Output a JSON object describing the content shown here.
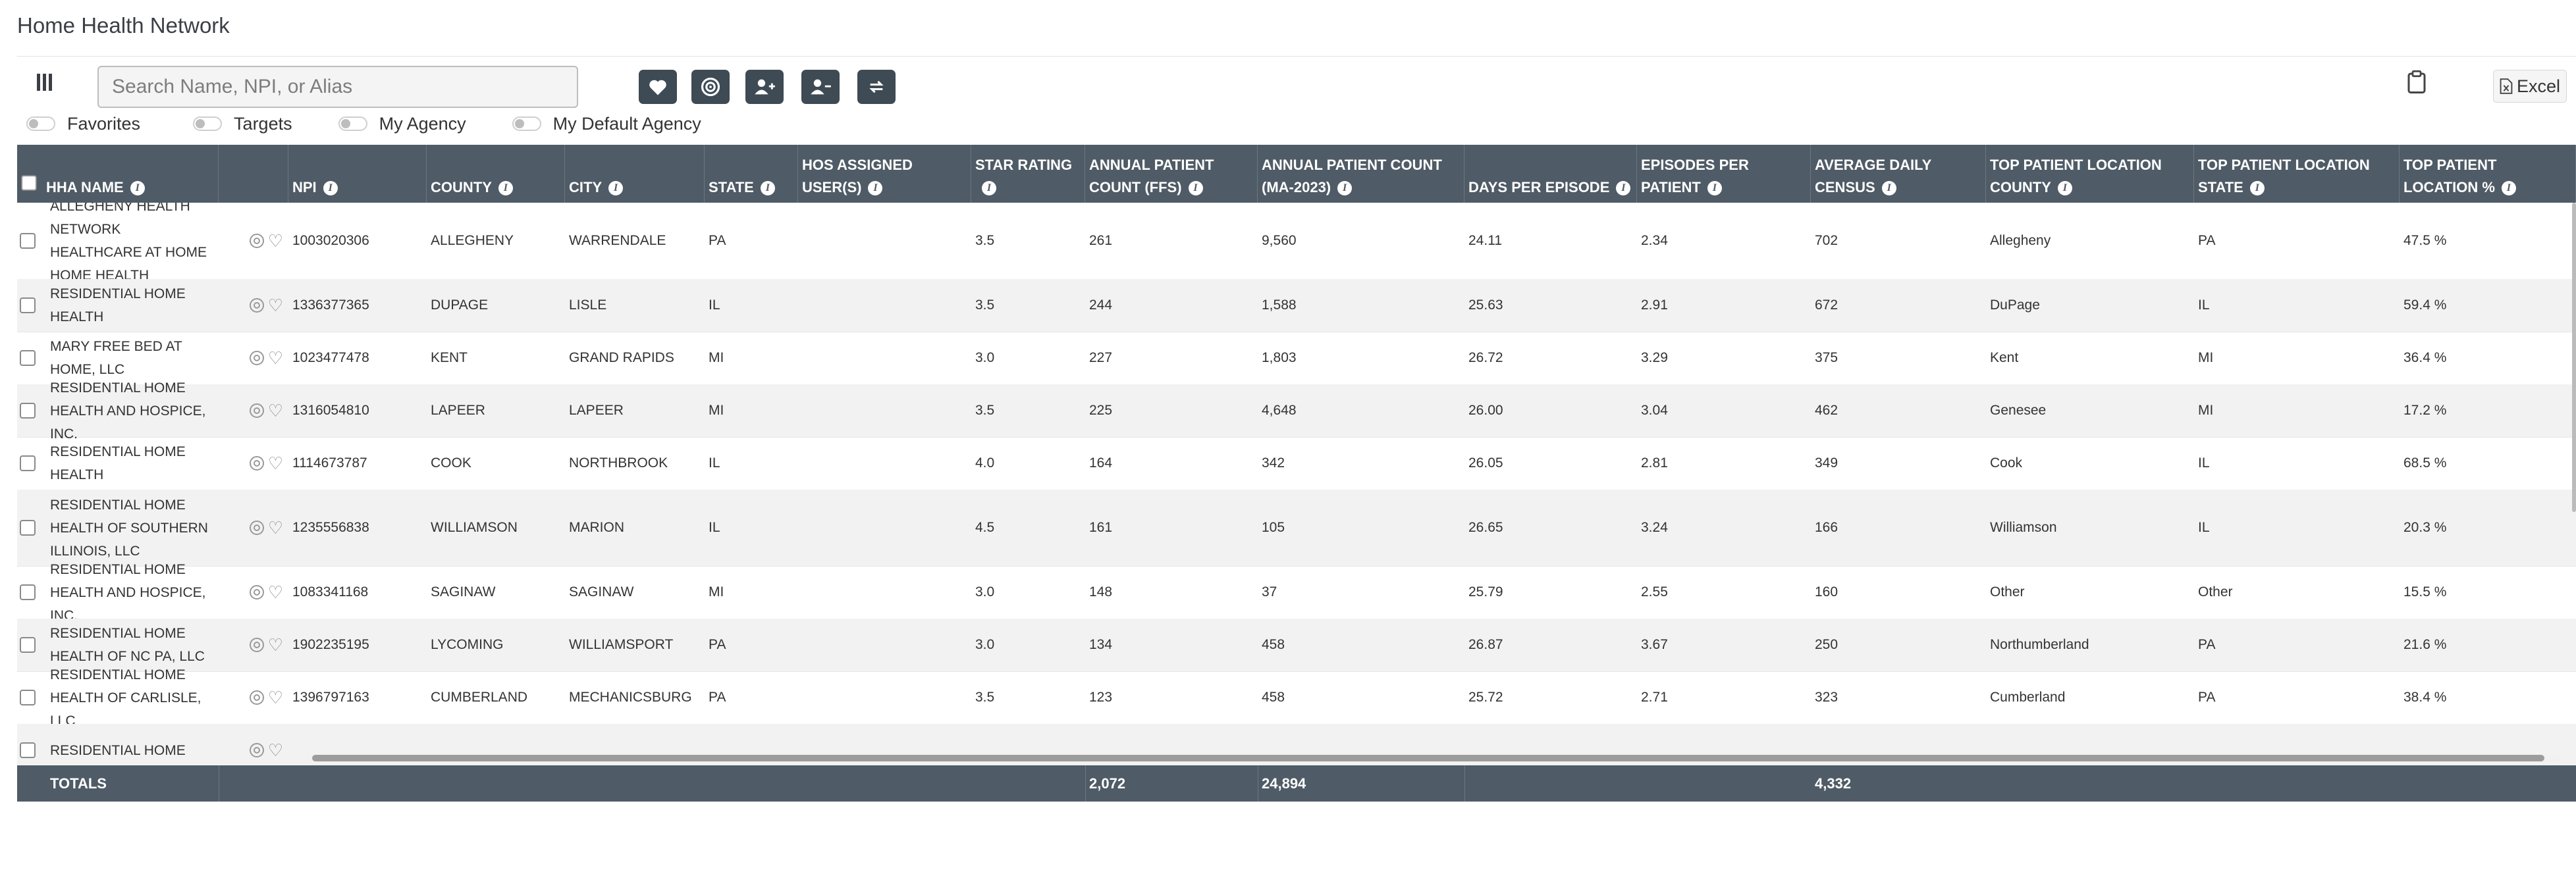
{
  "page": {
    "title": "Home Health Network"
  },
  "toolbar": {
    "search_placeholder": "Search Name, NPI, or Alias",
    "excel_label": "Excel"
  },
  "toggles": [
    "Favorites",
    "Targets",
    "My Agency",
    "My Default Agency"
  ],
  "table": {
    "columns": [
      "HHA NAME",
      "",
      "NPI",
      "COUNTY",
      "CITY",
      "STATE",
      "HOS ASSIGNED USER(S)",
      "STAR RATING",
      "ANNUAL PATIENT COUNT (FFS)",
      "ANNUAL PATIENT COUNT (MA-2023)",
      "DAYS PER EPISODE",
      "EPISODES PER PATIENT",
      "AVERAGE DAILY CENSUS",
      "TOP PATIENT LOCATION COUNTY",
      "TOP PATIENT LOCATION STATE",
      "TOP PATIENT LOCATION %"
    ],
    "rows": [
      {
        "name": "ALLEGHENY HEALTH NETWORK HEALTHCARE AT HOME HOME HEALTH",
        "npi": "1003020306",
        "county": "ALLEGHENY",
        "city": "WARRENDALE",
        "state": "PA",
        "hos": "",
        "star": "3.5",
        "ffs": "261",
        "ma": "9,560",
        "dpe": "24.11",
        "epp": "2.34",
        "adc": "702",
        "tpl_county": "Allegheny",
        "tpl_state": "PA",
        "tpl_pct": "47.5 %"
      },
      {
        "name": "RESIDENTIAL HOME HEALTH",
        "npi": "1336377365",
        "county": "DUPAGE",
        "city": "LISLE",
        "state": "IL",
        "hos": "",
        "star": "3.5",
        "ffs": "244",
        "ma": "1,588",
        "dpe": "25.63",
        "epp": "2.91",
        "adc": "672",
        "tpl_county": "DuPage",
        "tpl_state": "IL",
        "tpl_pct": "59.4 %"
      },
      {
        "name": "MARY FREE BED AT HOME, LLC",
        "npi": "1023477478",
        "county": "KENT",
        "city": "GRAND RAPIDS",
        "state": "MI",
        "hos": "",
        "star": "3.0",
        "ffs": "227",
        "ma": "1,803",
        "dpe": "26.72",
        "epp": "3.29",
        "adc": "375",
        "tpl_county": "Kent",
        "tpl_state": "MI",
        "tpl_pct": "36.4 %"
      },
      {
        "name": "RESIDENTIAL HOME HEALTH AND HOSPICE, INC.",
        "npi": "1316054810",
        "county": "LAPEER",
        "city": "LAPEER",
        "state": "MI",
        "hos": "",
        "star": "3.5",
        "ffs": "225",
        "ma": "4,648",
        "dpe": "26.00",
        "epp": "3.04",
        "adc": "462",
        "tpl_county": "Genesee",
        "tpl_state": "MI",
        "tpl_pct": "17.2 %"
      },
      {
        "name": "RESIDENTIAL HOME HEALTH",
        "npi": "1114673787",
        "county": "COOK",
        "city": "NORTHBROOK",
        "state": "IL",
        "hos": "",
        "star": "4.0",
        "ffs": "164",
        "ma": "342",
        "dpe": "26.05",
        "epp": "2.81",
        "adc": "349",
        "tpl_county": "Cook",
        "tpl_state": "IL",
        "tpl_pct": "68.5 %"
      },
      {
        "name": "RESIDENTIAL HOME HEALTH OF SOUTHERN ILLINOIS, LLC",
        "npi": "1235556838",
        "county": "WILLIAMSON",
        "city": "MARION",
        "state": "IL",
        "hos": "",
        "star": "4.5",
        "ffs": "161",
        "ma": "105",
        "dpe": "26.65",
        "epp": "3.24",
        "adc": "166",
        "tpl_county": "Williamson",
        "tpl_state": "IL",
        "tpl_pct": "20.3 %"
      },
      {
        "name": "RESIDENTIAL HOME HEALTH AND HOSPICE, INC.",
        "npi": "1083341168",
        "county": "SAGINAW",
        "city": "SAGINAW",
        "state": "MI",
        "hos": "",
        "star": "3.0",
        "ffs": "148",
        "ma": "37",
        "dpe": "25.79",
        "epp": "2.55",
        "adc": "160",
        "tpl_county": "Other",
        "tpl_state": "Other",
        "tpl_pct": "15.5 %"
      },
      {
        "name": "RESIDENTIAL HOME HEALTH OF NC PA, LLC",
        "npi": "1902235195",
        "county": "LYCOMING",
        "city": "WILLIAMSPORT",
        "state": "PA",
        "hos": "",
        "star": "3.0",
        "ffs": "134",
        "ma": "458",
        "dpe": "26.87",
        "epp": "3.67",
        "adc": "250",
        "tpl_county": "Northumberland",
        "tpl_state": "PA",
        "tpl_pct": "21.6 %"
      },
      {
        "name": "RESIDENTIAL HOME HEALTH OF CARLISLE, LLC",
        "npi": "1396797163",
        "county": "CUMBERLAND",
        "city": "MECHANICSBURG",
        "state": "PA",
        "hos": "",
        "star": "3.5",
        "ffs": "123",
        "ma": "458",
        "dpe": "25.72",
        "epp": "2.71",
        "adc": "323",
        "tpl_county": "Cumberland",
        "tpl_state": "PA",
        "tpl_pct": "38.4 %"
      },
      {
        "name": "RESIDENTIAL HOME",
        "npi": "",
        "county": "",
        "city": "",
        "state": "",
        "hos": "",
        "star": "",
        "ffs": "",
        "ma": "",
        "dpe": "",
        "epp": "",
        "adc": "",
        "tpl_county": "",
        "tpl_state": "",
        "tpl_pct": ""
      }
    ],
    "totals": {
      "label": "TOTALS",
      "ffs": "2,072",
      "ma": "24,894",
      "adc": "4,332"
    }
  }
}
